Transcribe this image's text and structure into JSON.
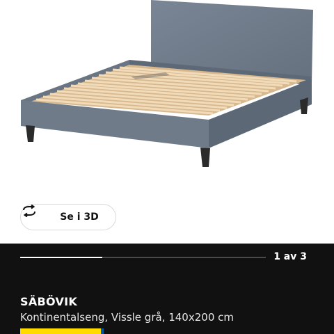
{
  "viewer": {
    "view3d_label": "Se i 3D",
    "view3d_icon": "rotate-arrows-icon"
  },
  "gallery": {
    "pager_text": "1 av 3",
    "progress": 0.333
  },
  "product": {
    "name": "SÄBÖVIK",
    "description": "Kontinentalseng, Vissle grå, 140x200 cm"
  },
  "colors": {
    "panel_background": "#111111",
    "bed_fabric": "#6f7b8b",
    "slats": "#e6c9a1",
    "brand_yellow": "#ffdb00",
    "brand_blue": "#0058a3"
  }
}
